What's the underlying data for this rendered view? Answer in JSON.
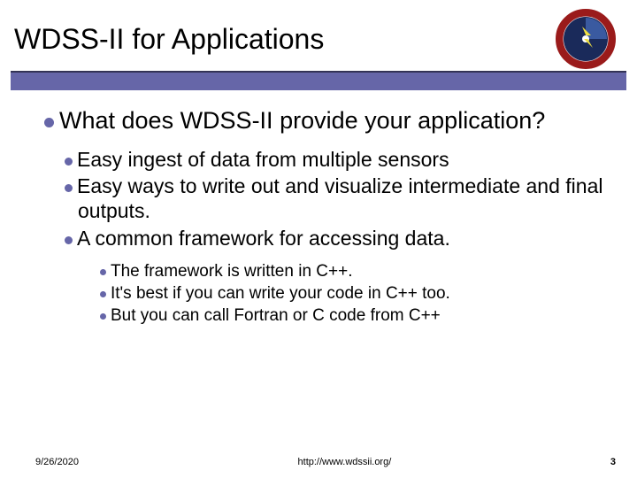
{
  "title": "WDSS-II for Applications",
  "logo_alt": "NSSL National Severe Storms Laboratory",
  "main_bullet": "What does WDSS-II provide your application?",
  "sub_bullets": [
    "Easy ingest of data from multiple sensors",
    "Easy ways to write out and visualize intermediate and final outputs.",
    "A common framework for accessing data."
  ],
  "sub_sub_bullets": [
    "The framework is written in C++.",
    "It's best if you can write your code in C++ too.",
    "But you can call Fortran or C code from C++"
  ],
  "footer": {
    "date": "9/26/2020",
    "url": "http://www.wdssii.org/",
    "page": "3"
  }
}
